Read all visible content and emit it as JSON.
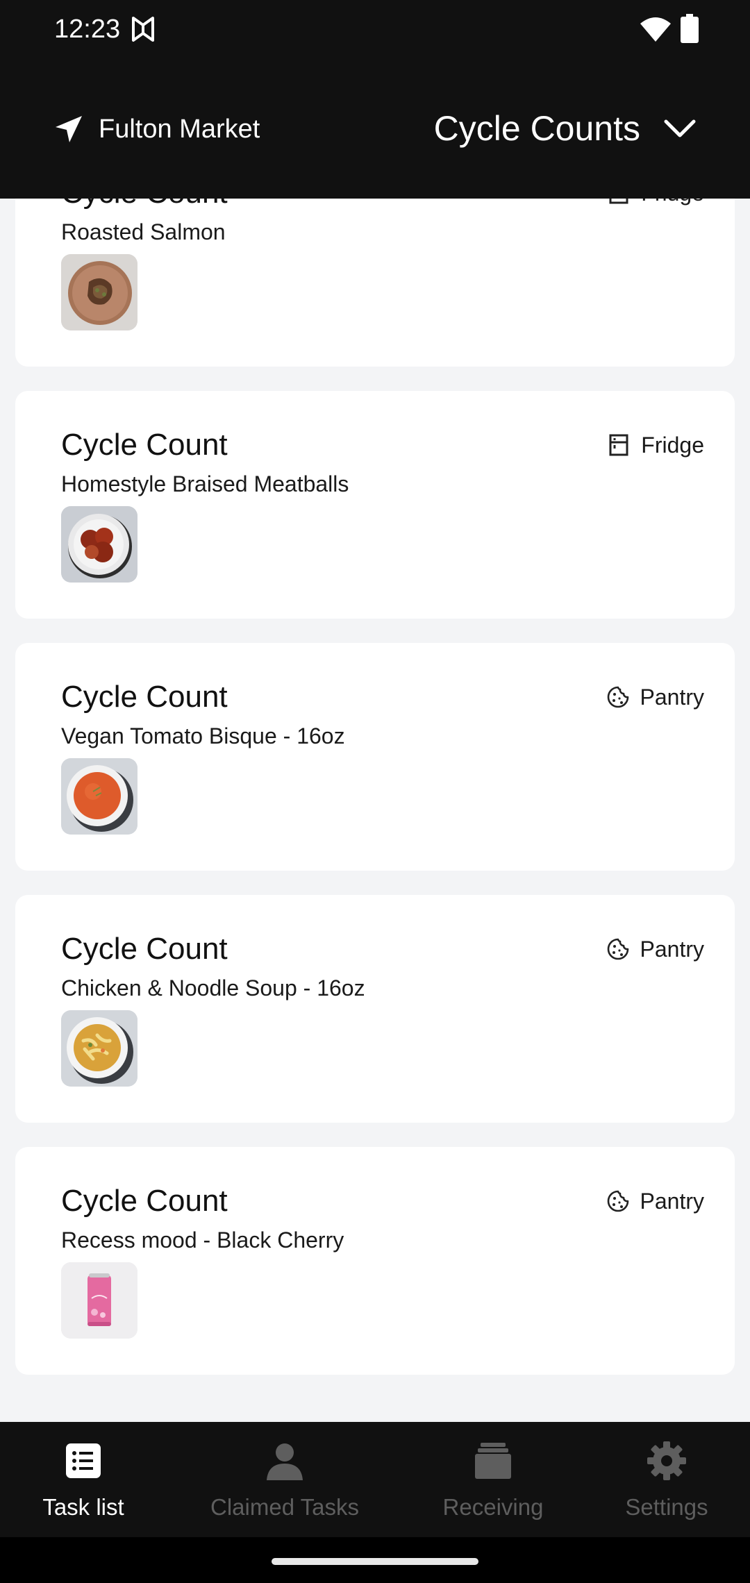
{
  "status_bar": {
    "time": "12:23"
  },
  "header": {
    "location_name": "Fulton Market",
    "view_label": "Cycle Counts"
  },
  "tasks": [
    {
      "title": "Cycle Count",
      "item": "Roasted Salmon",
      "location": "Fridge",
      "location_icon": "fridge-icon",
      "thumb": "roasted-salmon"
    },
    {
      "title": "Cycle Count",
      "item": "Homestyle Braised Meatballs",
      "location": "Fridge",
      "location_icon": "fridge-icon",
      "thumb": "meatballs"
    },
    {
      "title": "Cycle Count",
      "item": "Vegan Tomato Bisque - 16oz",
      "location": "Pantry",
      "location_icon": "cookie-icon",
      "thumb": "tomato-bisque"
    },
    {
      "title": "Cycle Count",
      "item": "Chicken & Noodle Soup - 16oz",
      "location": "Pantry",
      "location_icon": "cookie-icon",
      "thumb": "noodle-soup"
    },
    {
      "title": "Cycle Count",
      "item": "Recess mood - Black Cherry",
      "location": "Pantry",
      "location_icon": "cookie-icon",
      "thumb": "recess-can"
    }
  ],
  "bottom_nav": [
    {
      "label": "Task list",
      "icon": "task-list-icon",
      "active": true
    },
    {
      "label": "Claimed Tasks",
      "icon": "person-icon",
      "active": false
    },
    {
      "label": "Receiving",
      "icon": "stack-icon",
      "active": false
    },
    {
      "label": "Settings",
      "icon": "gear-icon",
      "active": false
    }
  ],
  "colors": {
    "chrome": "#111111",
    "background": "#f3f4f6",
    "card": "#ffffff",
    "nav_inactive": "#5e5e5e",
    "nav_active": "#ffffff"
  }
}
